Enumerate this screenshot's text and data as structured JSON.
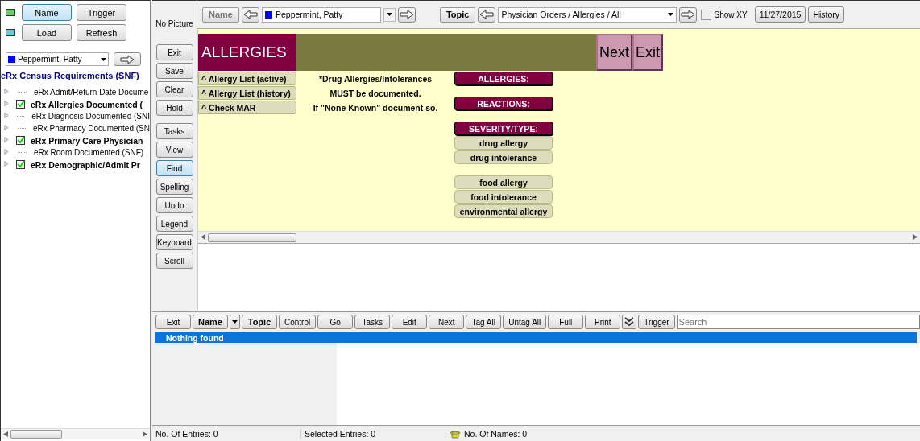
{
  "left_panel": {
    "buttons": [
      {
        "label": "Name",
        "selected": true
      },
      {
        "label": "Trigger",
        "selected": false
      },
      {
        "label": "Load",
        "selected": false
      },
      {
        "label": "Refresh",
        "selected": false
      }
    ],
    "resident_select": {
      "value": "Peppermint, Patty"
    },
    "title": "eRx Census Requirements (SNF)",
    "tree": [
      {
        "label": "eRx Admit/Return Date Docume",
        "checked": false,
        "expanded": false
      },
      {
        "label": "eRx Allergies Documented (",
        "checked": true,
        "expanded": false
      },
      {
        "label": "eRx Diagnosis Documented (SNI",
        "checked": false,
        "expanded": false
      },
      {
        "label": "eRx Pharmacy Documented (SN",
        "checked": false,
        "expanded": false
      },
      {
        "label": "eRx Primary Care Physician",
        "checked": true,
        "expanded": false
      },
      {
        "label": "eRx Room Documented (SNF)",
        "checked": false,
        "expanded": false
      },
      {
        "label": "eRx Demographic/Admit Pr",
        "checked": true,
        "expanded": false
      }
    ]
  },
  "side_column": {
    "picture_label": "No Picture",
    "button_groups": [
      [
        {
          "label": "Exit",
          "selected": false
        },
        {
          "label": "Save",
          "selected": false
        },
        {
          "label": "Clear",
          "selected": false
        },
        {
          "label": "Hold",
          "selected": false
        }
      ],
      [
        {
          "label": "Tasks",
          "selected": false
        },
        {
          "label": "View",
          "selected": false
        },
        {
          "label": "Find",
          "selected": true
        },
        {
          "label": "Spelling",
          "selected": false
        },
        {
          "label": "Undo",
          "selected": false
        },
        {
          "label": "Legend",
          "selected": false
        },
        {
          "label": "Keyboard",
          "selected": false
        },
        {
          "label": "Scroll",
          "selected": false
        }
      ]
    ]
  },
  "toolbar": {
    "name_label": "Name",
    "name_value": "Peppermint, Patty",
    "topic_label": "Topic",
    "topic_value": "Physician Orders / Allergies / All",
    "show_xy": {
      "label": "Show XY",
      "checked": false
    },
    "date": "11/27/2015",
    "history": "History"
  },
  "form": {
    "title": "ALLERGIES",
    "nav_buttons": [
      "Next",
      "Exit"
    ],
    "links": [
      "^ Allergy List (active)",
      "^ Allergy List (history)",
      "^ Check MAR"
    ],
    "instructions": [
      "*Drug Allergies/Intolerances",
      "MUST be documented.",
      "If \"None Known\" document so."
    ],
    "groups": [
      {
        "header": "ALLERGIES:"
      },
      {
        "header": "REACTIONS:"
      },
      {
        "header": "SEVERITY/TYPE:",
        "options": [
          "drug allergy",
          "drug intolerance"
        ]
      },
      {
        "options": [
          "food allergy",
          "food intolerance",
          "environmental allergy"
        ]
      }
    ]
  },
  "bottom_toolbar": {
    "buttons": [
      {
        "kind": "text",
        "label": "Exit",
        "emphasized": false
      },
      {
        "kind": "text",
        "label": "Name",
        "emphasized": true
      },
      {
        "kind": "dropdown"
      },
      {
        "kind": "text",
        "label": "Topic",
        "emphasized": true
      },
      {
        "kind": "text",
        "label": "Control",
        "emphasized": false
      },
      {
        "kind": "text",
        "label": "Go",
        "emphasized": false
      },
      {
        "kind": "text",
        "label": "Tasks",
        "emphasized": false
      },
      {
        "kind": "text",
        "label": "Edit",
        "emphasized": false
      },
      {
        "kind": "text",
        "label": "Next",
        "emphasized": false
      },
      {
        "kind": "text",
        "label": "Tag All",
        "emphasized": false
      },
      {
        "kind": "text",
        "label": "Untag All",
        "emphasized": false
      },
      {
        "kind": "text",
        "label": "Full",
        "emphasized": false
      },
      {
        "kind": "text",
        "label": "Print",
        "emphasized": false
      },
      {
        "kind": "chevrons"
      },
      {
        "kind": "text",
        "label": "Trigger",
        "emphasized": false
      }
    ],
    "search": {
      "placeholder": "Search"
    }
  },
  "results": {
    "header": "Nothing found"
  },
  "status_bar": {
    "entries": "No. Of Entries: 0",
    "selected": "Selected Entries: 0",
    "names": "No. Of Names: 0"
  }
}
